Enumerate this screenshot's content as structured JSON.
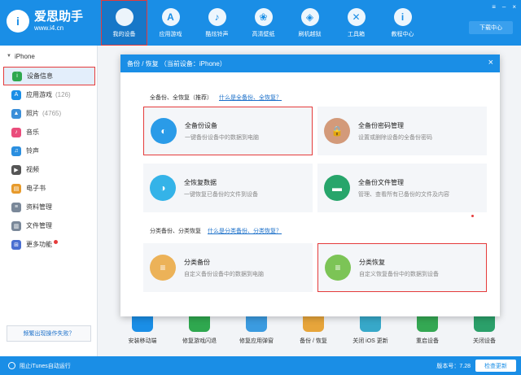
{
  "app": {
    "name": "爱思助手",
    "url": "www.i4.cn",
    "logo_letter": "i"
  },
  "nav": [
    {
      "label": "我的设备",
      "icon": "apple-icon",
      "glyph": "",
      "active": true
    },
    {
      "label": "应用游戏",
      "icon": "app-store-icon",
      "glyph": "A"
    },
    {
      "label": "酷炫铃声",
      "icon": "bell-icon",
      "glyph": "♪"
    },
    {
      "label": "高清壁纸",
      "icon": "wallpaper-icon",
      "glyph": "❀"
    },
    {
      "label": "刷机越狱",
      "icon": "dropbox-icon",
      "glyph": "◈"
    },
    {
      "label": "工具箱",
      "icon": "tools-icon",
      "glyph": "✕"
    },
    {
      "label": "教程中心",
      "icon": "info-icon",
      "glyph": "i"
    }
  ],
  "window": {
    "download_label": "下载中心",
    "controls": [
      "≡",
      "–",
      "×"
    ]
  },
  "sidebar": {
    "device": "iPhone",
    "items": [
      {
        "label": "设备信息",
        "count": "",
        "icon": "info-icon",
        "color": "#2fa84f",
        "glyph": "i",
        "active": true
      },
      {
        "label": "应用游戏",
        "count": "(126)",
        "icon": "app-store-icon",
        "color": "#1a8ee6",
        "glyph": "A"
      },
      {
        "label": "照片",
        "count": "(4765)",
        "icon": "photo-icon",
        "color": "#3b8fd9",
        "glyph": "▲"
      },
      {
        "label": "音乐",
        "count": "",
        "icon": "music-icon",
        "color": "#ea4d7c",
        "glyph": "♪"
      },
      {
        "label": "铃声",
        "count": "",
        "icon": "bell-icon",
        "color": "#2b8fe0",
        "glyph": "♫"
      },
      {
        "label": "视频",
        "count": "",
        "icon": "video-icon",
        "color": "#555555",
        "glyph": "▶"
      },
      {
        "label": "电子书",
        "count": "",
        "icon": "book-icon",
        "color": "#e79a2b",
        "glyph": "▤"
      },
      {
        "label": "资料管理",
        "count": "",
        "icon": "document-icon",
        "color": "#7a8899",
        "glyph": "≡"
      },
      {
        "label": "文件管理",
        "count": "",
        "icon": "folder-icon",
        "color": "#7a8899",
        "glyph": "▥"
      },
      {
        "label": "更多功能",
        "count": "",
        "icon": "grid-icon",
        "color": "#4a6fd1",
        "glyph": "⊞",
        "dot": true
      }
    ],
    "feedback": "频繁出现操作失败？"
  },
  "bg_tools": [
    {
      "label": "安装移动端",
      "color": "#1a8ee6"
    },
    {
      "label": "修复游戏闪退",
      "color": "#2fa84f"
    },
    {
      "label": "修复应用弹窗",
      "color": "#3b9be0"
    },
    {
      "label": "备份 / 恢复",
      "color": "#e7a53b"
    },
    {
      "label": "关闭 iOS 更新",
      "color": "#37a8c9"
    },
    {
      "label": "重启设备",
      "color": "#34a853"
    },
    {
      "label": "关闭设备",
      "color": "#2ba06a"
    }
  ],
  "status": {
    "itunes": "阻止iTunes自动运行",
    "version": "版本号：7.28",
    "update": "检查更新"
  },
  "dialog": {
    "title": "备份 / 恢复   （当前设备：iPhone）",
    "close": "×",
    "section1": {
      "title": "全备份、全恢复（推荐）",
      "link": "什么是全备份、全恢复？"
    },
    "section2": {
      "title": "分类备份、分类恢复",
      "link": "什么是分类备份、分类恢复？"
    },
    "cards": [
      {
        "title": "全备份设备",
        "desc": "一键备份设备中的数据到电脑",
        "icon": "backup-icon",
        "color": "#2a9be8",
        "glyph": "◐",
        "highlight": true
      },
      {
        "title": "全备份密码管理",
        "desc": "设置或删除设备的全备份密码",
        "icon": "lock-icon",
        "color": "#d39a7a",
        "glyph": "🔒"
      },
      {
        "title": "全恢复数据",
        "desc": "一键恢复已备份的文件到设备",
        "icon": "restore-icon",
        "color": "#34b3e8",
        "glyph": "◑"
      },
      {
        "title": "全备份文件管理",
        "desc": "管理、查看所有已备份的文件及内容",
        "icon": "folder-icon",
        "color": "#27a56b",
        "glyph": "▬"
      },
      {
        "title": "分类备份",
        "desc": "自定义备份设备中的数据到电脑",
        "icon": "category-backup-icon",
        "color": "#ecb258",
        "glyph": "≡"
      },
      {
        "title": "分类恢复",
        "desc": "自定义恢复备份中的数据到设备",
        "icon": "category-restore-icon",
        "color": "#7cc456",
        "glyph": "≡",
        "highlight": true
      }
    ]
  }
}
